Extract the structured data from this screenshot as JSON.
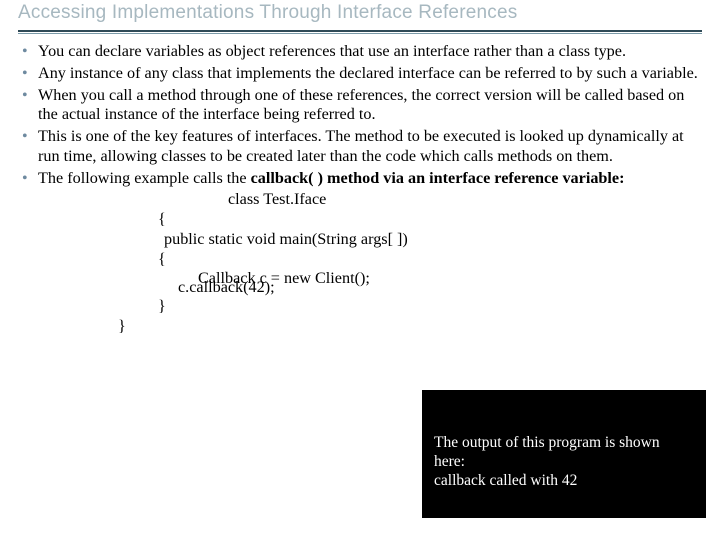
{
  "title": "Accessing Implementations Through Interface References",
  "bullets": {
    "b1": "You can declare variables as object references that use an interface rather than a class type.",
    "b2": "Any instance of any class that implements the declared interface can be referred to by such a variable.",
    "b3": "When you call a method through one of these references, the correct version will be called based on the actual instance of the interface being referred to.",
    "b4": "This is one of the key features of interfaces. The method to be executed is looked up dynamically at run time, allowing classes to be created later than the code which calls methods on them.",
    "b5_prefix": "The following example calls the ",
    "b5_bold": "callback( ) method via an interface reference variable:"
  },
  "code": {
    "l1": "class Test.Iface",
    "l2": "{",
    "l3": " public static void main(String args[ ])",
    "l4": "{",
    "l5a": "Callback c = new Client();",
    "l5b": "c.callback(42);",
    "l6": "}",
    "l7": "}"
  },
  "output": {
    "line1": "The output of this program is shown",
    "line2": "here:",
    "line3": "callback called with 42"
  }
}
